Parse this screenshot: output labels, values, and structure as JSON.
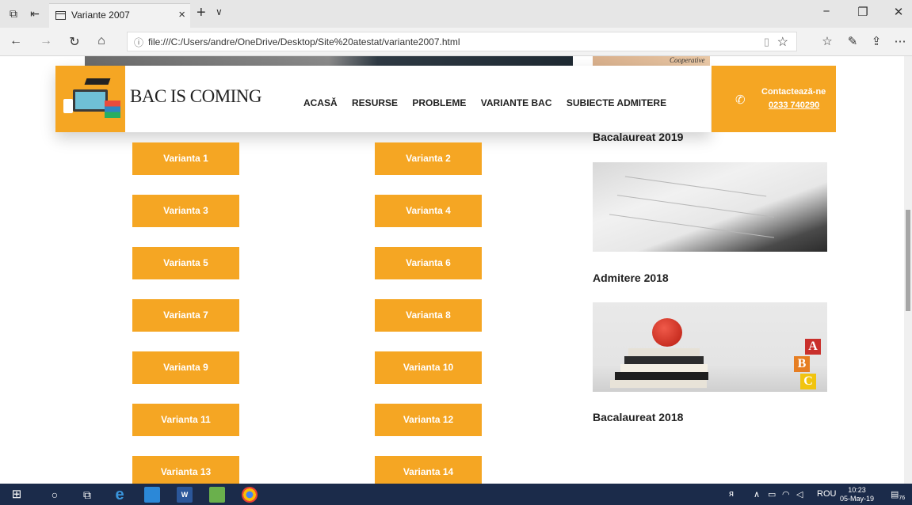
{
  "browser": {
    "tab_title": "Variante 2007",
    "url": "file:///C:/Users/andre/OneDrive/Desktop/Site%20atestat/variante2007.html"
  },
  "header": {
    "brand": "BAC IS COMING",
    "nav": [
      "ACASĂ",
      "RESURSE",
      "PROBLEME",
      "VARIANTE BAC",
      "SUBIECTE ADMITERE"
    ],
    "contact_title": "Contactează-ne",
    "contact_phone": "0233 740290"
  },
  "variants_left": [
    "Varianta 1",
    "Varianta 3",
    "Varianta 5",
    "Varianta 7",
    "Varianta 9",
    "Varianta 11",
    "Varianta 13"
  ],
  "variants_right": [
    "Varianta 2",
    "Varianta 4",
    "Varianta 6",
    "Varianta 8",
    "Varianta 10",
    "Varianta 12",
    "Varianta 14"
  ],
  "sidebar": {
    "title_top": "Bacalaureat 2019",
    "title_mid": "Admitere 2018",
    "title_bottom": "Bacalaureat 2018",
    "peek_text": "Cooperative"
  },
  "apple_blocks": [
    "A",
    "B",
    "C"
  ],
  "taskbar": {
    "lang": "ROU",
    "time": "10:23",
    "date": "05-May-19",
    "notif_count": "76"
  },
  "colors": {
    "accent": "#f5a623",
    "taskbar": "#1b2b4a"
  }
}
